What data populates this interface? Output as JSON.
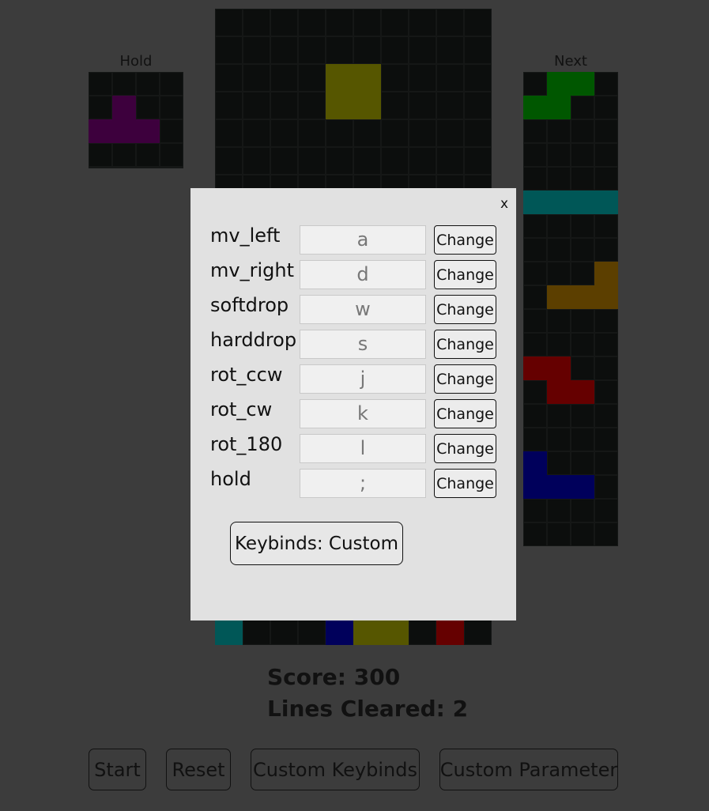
{
  "colors": {
    "T": "#3d003d",
    "S": "#005700",
    "I": "#005757",
    "L": "#5c3f00",
    "Z": "#650000",
    "J": "#00005b",
    "O": "#565600"
  },
  "hold": {
    "label": "Hold",
    "rows": [
      "....",
      ".T..",
      "TTT.",
      "....",
      "...."
    ]
  },
  "next": {
    "label": "Next",
    "rows": [
      ".SS.",
      "SS..",
      "....",
      "....",
      "....",
      "IIII",
      "....",
      "....",
      "...L",
      ".LLL",
      "....",
      "....",
      "ZZ..",
      ".ZZ.",
      "....",
      "....",
      "J...",
      "JJJ.",
      "....",
      "...."
    ]
  },
  "board": {
    "rows": [
      "..........",
      "..........",
      "....OO....",
      "....OO....",
      "..........",
      "..........",
      "..........",
      "..........",
      "..........",
      "..........",
      "..........",
      "..........",
      "..........",
      "..........",
      "..........",
      "..........",
      "..........",
      "..........",
      "..........",
      "..........",
      "..........",
      "..........",
      "I...JOO.Z."
    ]
  },
  "stats": {
    "score": "Score: 300",
    "lines": "Lines Cleared: 2"
  },
  "buttons": {
    "start": "Start",
    "reset": "Reset",
    "custom_keybinds": "Custom Keybinds",
    "custom_parameter": "Custom Parameter"
  },
  "keybind_dialog": {
    "close": "x",
    "change_label": "Change",
    "preset": "Keybinds: Custom",
    "rows": [
      {
        "action": "mv_left",
        "key": "a"
      },
      {
        "action": "mv_right",
        "key": "d"
      },
      {
        "action": "softdrop",
        "key": "w"
      },
      {
        "action": "harddrop",
        "key": "s"
      },
      {
        "action": "rot_ccw",
        "key": "j"
      },
      {
        "action": "rot_cw",
        "key": "k"
      },
      {
        "action": "rot_180",
        "key": "l"
      },
      {
        "action": "hold",
        "key": ";"
      }
    ]
  }
}
